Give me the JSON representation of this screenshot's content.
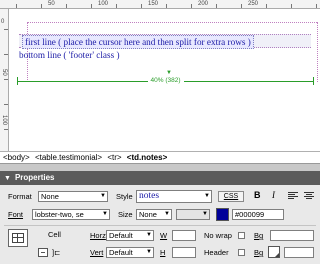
{
  "table": {
    "row1_text": "first line ( place the cursor here and then split for extra rows )",
    "row2_text": "bottom line ( 'footer' class )",
    "width_label": "40% (382)"
  },
  "rulers": {
    "top_labels": [
      "50",
      "100",
      "150",
      "200",
      "250"
    ],
    "left_labels": [
      "0",
      "50",
      "100"
    ]
  },
  "tag_selector": [
    "<body>",
    "<table.testimonial>",
    "<tr>",
    "<td.notes>"
  ],
  "properties": {
    "title": "Properties",
    "format_label": "Format",
    "format_value": "None",
    "style_label": "Style",
    "style_value": "notes",
    "css_label": "CSS",
    "bold_label": "B",
    "italic_label": "I",
    "font_label": "Font",
    "font_value": "lobster-two, se",
    "size_label": "Size",
    "size_value": "None",
    "color_value": "#000099",
    "cell_label": "Cell",
    "horz_label": "Horz",
    "horz_value": "Default",
    "w_label": "W",
    "nowrap_label": "No wrap",
    "bg_label": "Bg",
    "vert_label": "Vert",
    "vert_value": "Default",
    "h_label": "H",
    "header_label": "Header",
    "bg2_label": "Bg"
  },
  "colors": {
    "text_color_swatch": "#000099",
    "width_guide": "#2a9d2a",
    "cell_text": "#1a1aa6"
  },
  "icons": {
    "panel_collapse": "triangle-down-icon",
    "cell_layout": "table-cell-icon"
  }
}
